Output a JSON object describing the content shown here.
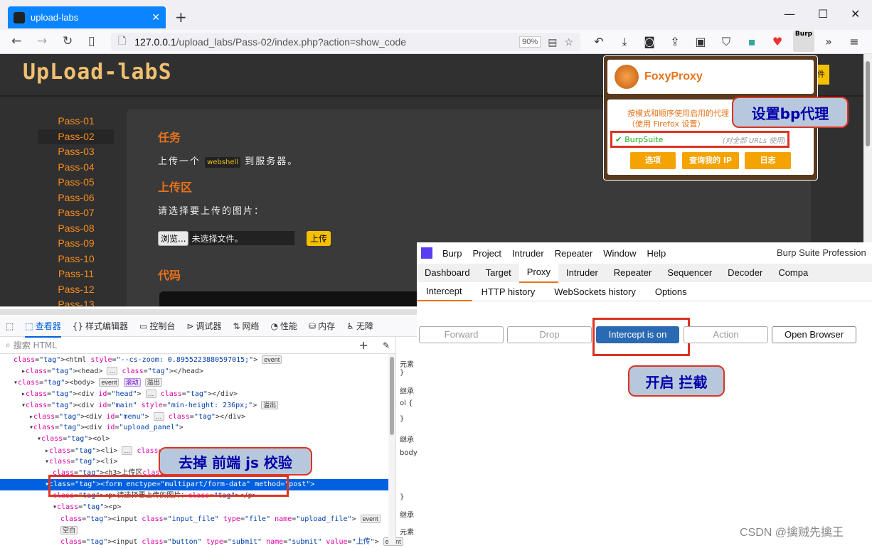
{
  "browser": {
    "tab_title": "upload-labs",
    "url_host": "127.0.0.1",
    "url_path": "/upload_labs/Pass-02/index.php?action=show_code",
    "zoom": "90%",
    "burp_ext_label": "Burp"
  },
  "page": {
    "logo": "UpLoad-labS",
    "menu": [
      "Pass-01",
      "Pass-02",
      "Pass-03",
      "Pass-04",
      "Pass-05",
      "Pass-06",
      "Pass-07",
      "Pass-08",
      "Pass-09",
      "Pass-10",
      "Pass-11",
      "Pass-12",
      "Pass-13"
    ],
    "active_pass": "Pass-02",
    "task_heading": "任务",
    "task_text_pre": "上传一个",
    "task_highlight": "webshell",
    "task_text_post": "到服务器。",
    "upload_heading": "上传区",
    "choose_text": "请选择要上传的图片：",
    "browse_label": "浏览...",
    "no_file": "未选择文件。",
    "upload_button": "上传",
    "code_heading": "代码"
  },
  "foxyproxy": {
    "title": "FoxyProxy",
    "desc": "按模式和顺序使用启用的代理 关闭（使用 Firefox 设置）",
    "proxy_check": "✔",
    "proxy_name": "BurpSuite",
    "proxy_scope": "(对全部 URLs 使用)",
    "buttons": [
      "选项",
      "查询我的 IP",
      "日志"
    ],
    "partial_label": "件"
  },
  "annotations": {
    "proxy": "设置bp代理",
    "intercept": "开启 拦截",
    "frontend": "去掉 前端 js 校验"
  },
  "devtools": {
    "tabs": [
      "查看器",
      "样式编辑器",
      "控制台",
      "调试器",
      "网络",
      "性能",
      "内存",
      "无障"
    ],
    "search_placeholder": "搜索 HTML",
    "rules_lines": [
      "元素",
      "}",
      "继承",
      "ol {",
      "}",
      "继承",
      "body",
      "}",
      "继承",
      "元素"
    ],
    "tree": [
      {
        "indent": 1,
        "html": "<html style=\"--cs-zoom: 0.8955223880597015;\">",
        "badges": [
          "event"
        ]
      },
      {
        "indent": 2,
        "html": "▸<head>",
        "badges": [
          "…"
        ],
        "after": "</head>"
      },
      {
        "indent": 1,
        "html": "▾<body>",
        "badges": [
          "event",
          "滚动",
          "溢出"
        ]
      },
      {
        "indent": 2,
        "html": "▸<div id=\"head\">",
        "badges": [
          "…"
        ],
        "after": "</div>"
      },
      {
        "indent": 2,
        "html": "▾<div id=\"main\" style=\"min-height: 236px;\">",
        "badges": [
          "溢出"
        ]
      },
      {
        "indent": 3,
        "html": "▸<div id=\"menu\">",
        "badges": [
          "…"
        ],
        "after": "</div>"
      },
      {
        "indent": 3,
        "html": "▾<div id=\"upload_panel\">",
        "badges": []
      },
      {
        "indent": 4,
        "html": "▾<ol>",
        "badges": []
      },
      {
        "indent": 5,
        "html": "▸<li>",
        "badges": [
          "…"
        ],
        "after": "</li>"
      },
      {
        "indent": 5,
        "html": "▾<li>",
        "badges": []
      },
      {
        "indent": 6,
        "html": "<h3>上传区</h3>",
        "badges": []
      },
      {
        "indent": 5,
        "html": "▾<form enctype=\"multipart/form-data\" method=\"post\">",
        "badges": [],
        "selected": true
      },
      {
        "indent": 6,
        "html": "<p>请选择要上传的图片：</p>",
        "badges": []
      },
      {
        "indent": 6,
        "html": "▾<p>",
        "badges": []
      },
      {
        "indent": 7,
        "html": "<input class=\"input_file\" type=\"file\" name=\"upload_file\">",
        "badges": [
          "event"
        ]
      },
      {
        "indent": 7,
        "html": "",
        "badges": [
          "空白"
        ]
      },
      {
        "indent": 7,
        "html": "<input class=\"button\" type=\"submit\" name=\"submit\" value=\"上传\">",
        "badges": [
          "event"
        ]
      }
    ]
  },
  "burp": {
    "menu": [
      "Burp",
      "Project",
      "Intruder",
      "Repeater",
      "Window",
      "Help"
    ],
    "title": "Burp Suite Profession",
    "tabs": [
      "Dashboard",
      "Target",
      "Proxy",
      "Intruder",
      "Repeater",
      "Sequencer",
      "Decoder",
      "Compa"
    ],
    "active_tab": "Proxy",
    "proxy_tabs": [
      "Intercept",
      "HTTP history",
      "WebSockets history",
      "Options"
    ],
    "buttons": {
      "forward": "Forward",
      "drop": "Drop",
      "intercept": "Intercept is on",
      "action": "Action",
      "open_browser": "Open Browser"
    }
  },
  "watermark": "CSDN @擒贼先擒王"
}
